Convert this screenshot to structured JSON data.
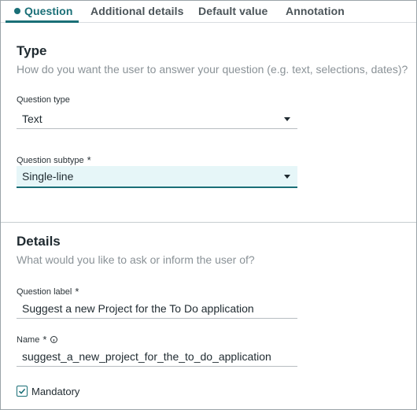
{
  "tabs": [
    {
      "label": "Question",
      "active": true
    },
    {
      "label": "Additional details",
      "active": false
    },
    {
      "label": "Default value",
      "active": false
    },
    {
      "label": "Annotation",
      "active": false
    }
  ],
  "type_section": {
    "title": "Type",
    "description": "How do you want the user to answer your question (e.g. text, selections, dates)?",
    "question_type": {
      "label": "Question type",
      "value": "Text"
    },
    "question_subtype": {
      "label": "Question subtype",
      "required_mark": "*",
      "value": "Single-line"
    }
  },
  "details_section": {
    "title": "Details",
    "description": "What would you like to ask or inform the user of?",
    "question_label": {
      "label": "Question label",
      "required_mark": "*",
      "value": "Suggest a new Project for the To Do application"
    },
    "name": {
      "label": "Name",
      "required_mark": "*",
      "value": "suggest_a_new_project_for_the_to_do_application"
    },
    "mandatory": {
      "label": "Mandatory",
      "checked": true
    }
  },
  "colors": {
    "accent": "#1a6f77",
    "focused_field_bg": "#e6f6f8",
    "muted_text": "#8a9297"
  },
  "icons": [
    "dot-indicator-icon",
    "caret-down-icon",
    "info-icon",
    "checkmark-icon"
  ]
}
